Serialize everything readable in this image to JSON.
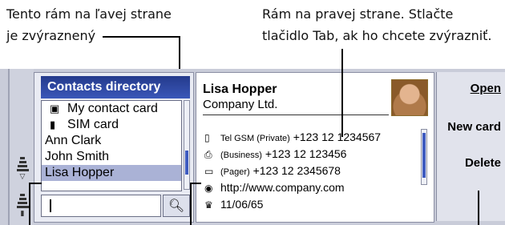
{
  "annotations": {
    "left_line1": "Tento rám na ľavej strane",
    "left_line2": "je zvýraznený",
    "right_line1": "Rám na pravej strane. Stlačte",
    "right_line2": "tlačidlo Tab, ak ho chcete zvýrazniť."
  },
  "contacts": {
    "title": "Contacts directory",
    "items": [
      {
        "label": "My contact card",
        "icon": "contact-card-icon",
        "glyph": "▣"
      },
      {
        "label": "SIM card",
        "icon": "sim-card-icon",
        "glyph": "▮"
      },
      {
        "label": "Ann Clark"
      },
      {
        "label": "John Smith"
      },
      {
        "label": "Lisa Hopper",
        "selected": true
      }
    ],
    "search_value": ""
  },
  "details": {
    "name": "Lisa Hopper",
    "company": "Company Ltd.",
    "rows": [
      {
        "icon": "mobile-phone-icon",
        "glyph": "▯",
        "label": "Tel GSM (Private)",
        "value": "+123 12 1234567"
      },
      {
        "icon": "fax-icon",
        "glyph": "⎙",
        "label": "(Business)",
        "value": "+123 12 123456"
      },
      {
        "icon": "pager-icon",
        "glyph": "▭",
        "label": "(Pager)",
        "value": "+123 12 2345678"
      },
      {
        "icon": "web-icon",
        "glyph": "◉",
        "label": "",
        "value": "http://www.company.com"
      },
      {
        "icon": "birthday-icon",
        "glyph": "♛",
        "label": "",
        "value": "11/06/65"
      }
    ]
  },
  "commands": {
    "open": "Open",
    "new_card": "New card",
    "delete": "Delete"
  },
  "colors": {
    "title_bar": "#2f4aa6",
    "selection": "#aab2d6",
    "frame": "#c9ccd9"
  }
}
